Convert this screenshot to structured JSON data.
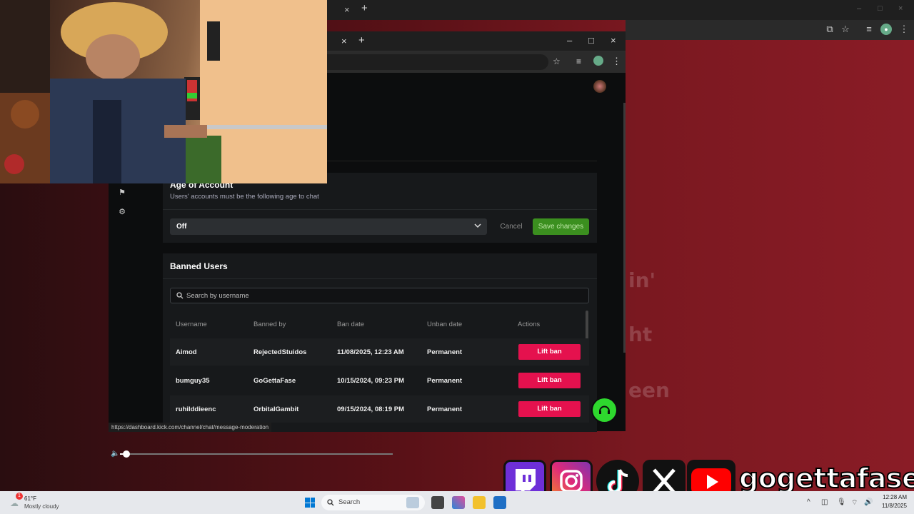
{
  "background_lyrics": [
    "in'",
    "ht",
    "een"
  ],
  "front_browser": {
    "tab_close": "×",
    "new_tab": "+",
    "win_minimize": "–",
    "win_maximize": "□",
    "win_close": "×"
  },
  "age_of_account": {
    "title": "Age of Account",
    "subtitle": "Users' accounts must be the following age to chat",
    "select_value": "Off",
    "cancel_label": "Cancel",
    "save_label": "Save changes"
  },
  "banned_users": {
    "title": "Banned Users",
    "search_placeholder": "Search by username",
    "columns": [
      "Username",
      "Banned by",
      "Ban date",
      "Unban date",
      "Actions"
    ],
    "rows": [
      {
        "username": "Aimod",
        "banned_by": "RejectedStuidos",
        "ban_date": "11/08/2025, 12:23 AM",
        "unban_date": "Permanent",
        "action": "Lift ban"
      },
      {
        "username": "bumguy35",
        "banned_by": "GoGettaFase",
        "ban_date": "10/15/2024, 09:23 PM",
        "unban_date": "Permanent",
        "action": "Lift ban"
      },
      {
        "username": "ruhilddieenc",
        "banned_by": "OrbitalGambit",
        "ban_date": "09/15/2024, 08:19 PM",
        "unban_date": "Permanent",
        "action": "Lift ban"
      }
    ]
  },
  "status_url": "https://dashboard.kick.com/channel/chat/message-moderation",
  "player": {
    "progress": 0.01
  },
  "social": {
    "handle": "gogettafase",
    "icons": [
      "twitch-icon",
      "instagram-icon",
      "tiktok-icon",
      "x-icon",
      "youtube-icon"
    ]
  },
  "taskbar": {
    "weather_temp": "61°F",
    "weather_desc": "Mostly cloudy",
    "weather_badge": "1",
    "search_label": "Search",
    "time": "12:28 AM",
    "date": "11/8/2025"
  },
  "colors": {
    "lift_ban": "#e5114e",
    "save": "#3b8f1f",
    "help": "#2ed82e"
  }
}
